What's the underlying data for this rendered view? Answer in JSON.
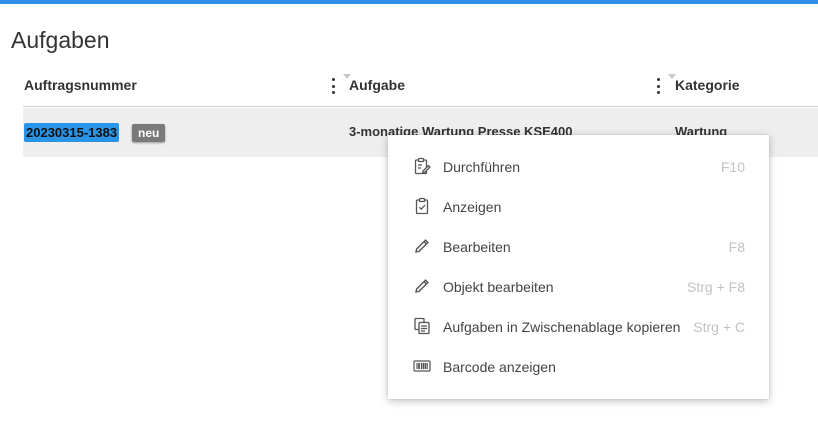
{
  "page": {
    "title": "Aufgaben"
  },
  "table": {
    "columns": [
      {
        "label": "Auftragsnummer"
      },
      {
        "label": "Aufgabe"
      },
      {
        "label": "Kategorie"
      }
    ],
    "rows": [
      {
        "order_number": "20230315-1383",
        "badge": "neu",
        "task": "3-monatige Wartung Presse KSE400",
        "category": "Wartung"
      }
    ]
  },
  "context_menu": {
    "items": [
      {
        "label": "Durchführen",
        "shortcut": "F10",
        "icon": "clipboard-edit-icon"
      },
      {
        "label": "Anzeigen",
        "shortcut": "",
        "icon": "clipboard-check-icon"
      },
      {
        "label": "Bearbeiten",
        "shortcut": "F8",
        "icon": "pencil-icon"
      },
      {
        "label": "Objekt bearbeiten",
        "shortcut": "Strg + F8",
        "icon": "pencil-icon"
      },
      {
        "label": "Aufgaben in Zwischenablage kopieren",
        "shortcut": "Strg + C",
        "icon": "copy-icon"
      },
      {
        "label": "Barcode anzeigen",
        "shortcut": "",
        "icon": "barcode-icon"
      }
    ]
  },
  "colors": {
    "accent": "#2f8fe6",
    "selection": "#2a95e8",
    "badge": "#7a7a7a",
    "row_bg": "#eeeeee"
  }
}
